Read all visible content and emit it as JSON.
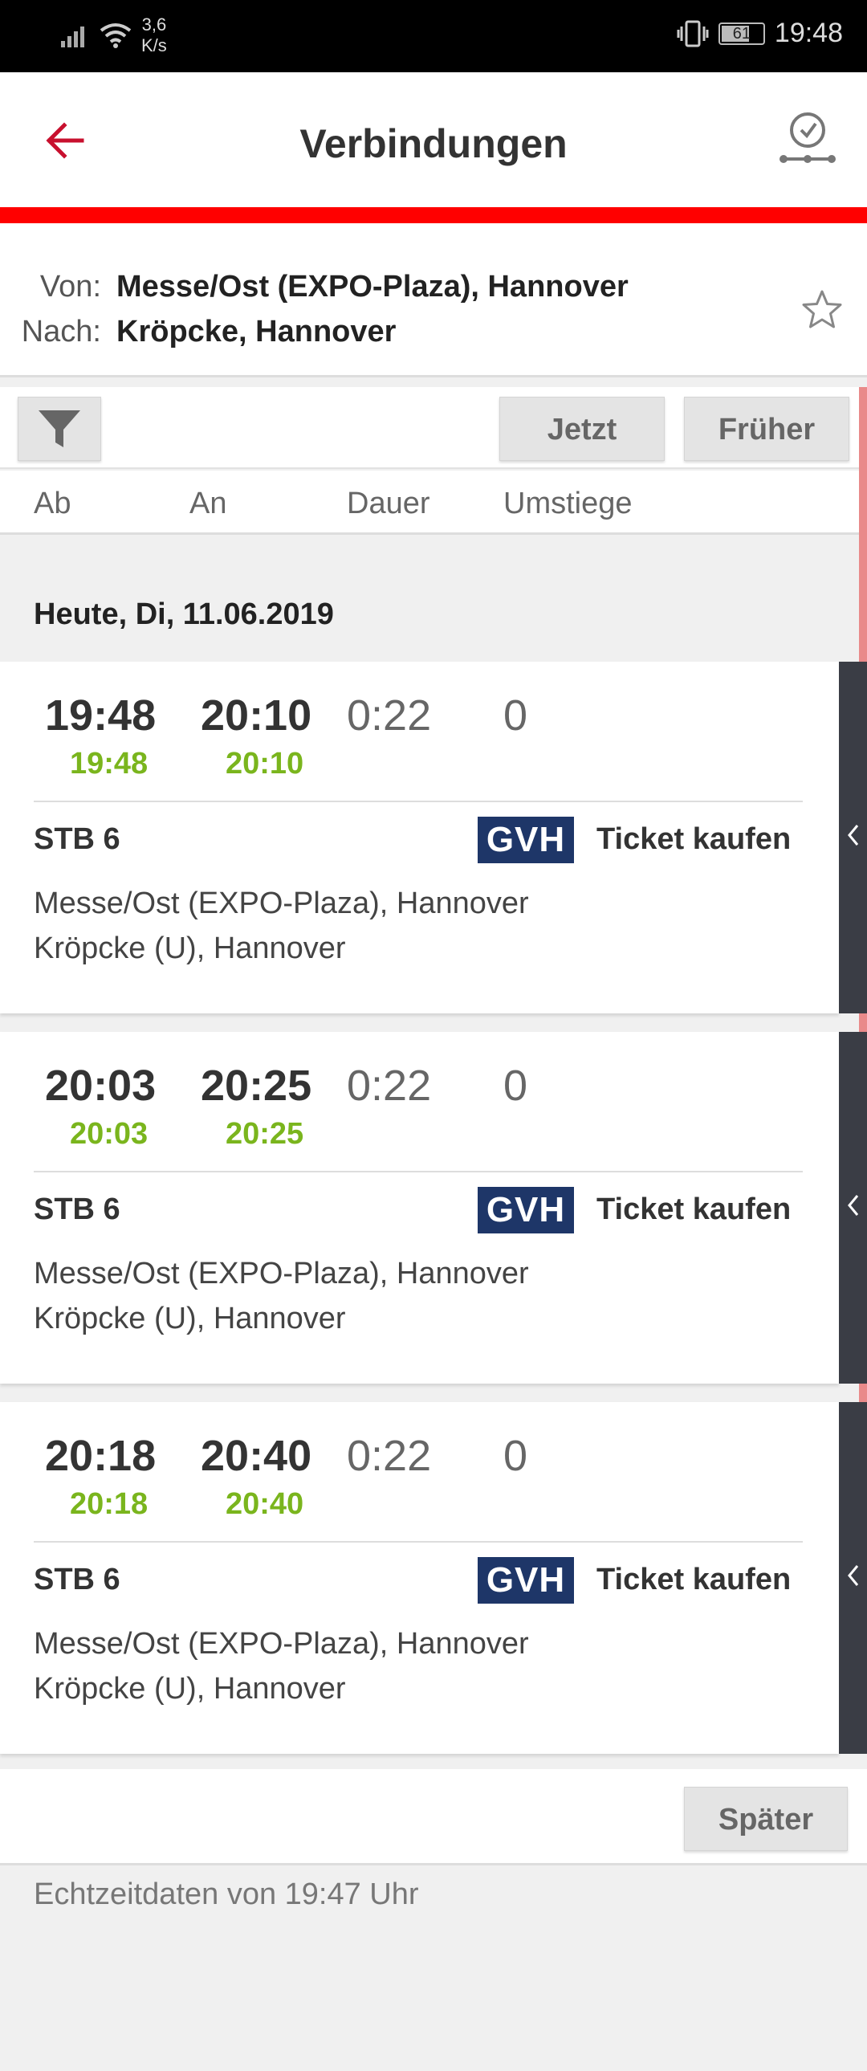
{
  "status_bar": {
    "speed_value": "3,6",
    "speed_unit": "K/s",
    "battery": "61",
    "time": "19:48"
  },
  "header": {
    "title": "Verbindungen"
  },
  "route": {
    "from_label": "Von:",
    "from_value": "Messe/Ost (EXPO-Plaza), Hannover",
    "to_label": "Nach:",
    "to_value": "Kröpcke, Hannover"
  },
  "toolbar": {
    "now_label": "Jetzt",
    "earlier_label": "Früher"
  },
  "columns": {
    "ab": "Ab",
    "an": "An",
    "dauer": "Dauer",
    "umstiege": "Umstiege"
  },
  "day_header": "Heute, Di, 11.06.2019",
  "connections": [
    {
      "dep": "19:48",
      "arr": "20:10",
      "dep_rt": "19:48",
      "arr_rt": "20:10",
      "duration": "0:22",
      "changes": "0",
      "line": "STB 6",
      "provider": "GVH",
      "ticket": "Ticket kaufen",
      "from": "Messe/Ost (EXPO-Plaza), Hannover",
      "to": "Kröpcke (U), Hannover"
    },
    {
      "dep": "20:03",
      "arr": "20:25",
      "dep_rt": "20:03",
      "arr_rt": "20:25",
      "duration": "0:22",
      "changes": "0",
      "line": "STB 6",
      "provider": "GVH",
      "ticket": "Ticket kaufen",
      "from": "Messe/Ost (EXPO-Plaza), Hannover",
      "to": "Kröpcke (U), Hannover"
    },
    {
      "dep": "20:18",
      "arr": "20:40",
      "dep_rt": "20:18",
      "arr_rt": "20:40",
      "duration": "0:22",
      "changes": "0",
      "line": "STB 6",
      "provider": "GVH",
      "ticket": "Ticket kaufen",
      "from": "Messe/Ost (EXPO-Plaza), Hannover",
      "to": "Kröpcke (U), Hannover"
    }
  ],
  "later_label": "Später",
  "footer": "Echtzeitdaten von 19:47 Uhr",
  "colors": {
    "accent_red": "#ff0000",
    "realtime_green": "#7ab51d",
    "gvh_blue": "#1e3668"
  }
}
